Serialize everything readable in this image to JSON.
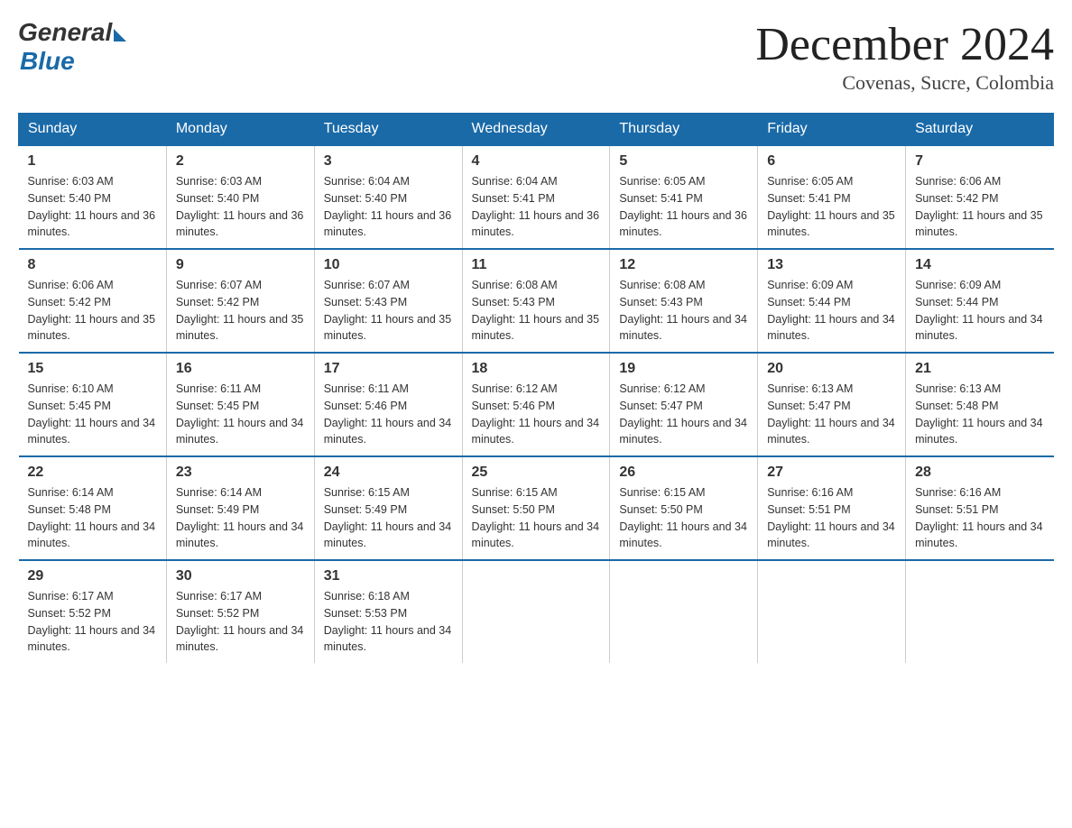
{
  "header": {
    "logo_general": "General",
    "logo_blue": "Blue",
    "month_title": "December 2024",
    "location": "Covenas, Sucre, Colombia"
  },
  "weekdays": [
    "Sunday",
    "Monday",
    "Tuesday",
    "Wednesday",
    "Thursday",
    "Friday",
    "Saturday"
  ],
  "weeks": [
    [
      {
        "day": "1",
        "sunrise": "6:03 AM",
        "sunset": "5:40 PM",
        "daylight": "11 hours and 36 minutes."
      },
      {
        "day": "2",
        "sunrise": "6:03 AM",
        "sunset": "5:40 PM",
        "daylight": "11 hours and 36 minutes."
      },
      {
        "day": "3",
        "sunrise": "6:04 AM",
        "sunset": "5:40 PM",
        "daylight": "11 hours and 36 minutes."
      },
      {
        "day": "4",
        "sunrise": "6:04 AM",
        "sunset": "5:41 PM",
        "daylight": "11 hours and 36 minutes."
      },
      {
        "day": "5",
        "sunrise": "6:05 AM",
        "sunset": "5:41 PM",
        "daylight": "11 hours and 36 minutes."
      },
      {
        "day": "6",
        "sunrise": "6:05 AM",
        "sunset": "5:41 PM",
        "daylight": "11 hours and 35 minutes."
      },
      {
        "day": "7",
        "sunrise": "6:06 AM",
        "sunset": "5:42 PM",
        "daylight": "11 hours and 35 minutes."
      }
    ],
    [
      {
        "day": "8",
        "sunrise": "6:06 AM",
        "sunset": "5:42 PM",
        "daylight": "11 hours and 35 minutes."
      },
      {
        "day": "9",
        "sunrise": "6:07 AM",
        "sunset": "5:42 PM",
        "daylight": "11 hours and 35 minutes."
      },
      {
        "day": "10",
        "sunrise": "6:07 AM",
        "sunset": "5:43 PM",
        "daylight": "11 hours and 35 minutes."
      },
      {
        "day": "11",
        "sunrise": "6:08 AM",
        "sunset": "5:43 PM",
        "daylight": "11 hours and 35 minutes."
      },
      {
        "day": "12",
        "sunrise": "6:08 AM",
        "sunset": "5:43 PM",
        "daylight": "11 hours and 34 minutes."
      },
      {
        "day": "13",
        "sunrise": "6:09 AM",
        "sunset": "5:44 PM",
        "daylight": "11 hours and 34 minutes."
      },
      {
        "day": "14",
        "sunrise": "6:09 AM",
        "sunset": "5:44 PM",
        "daylight": "11 hours and 34 minutes."
      }
    ],
    [
      {
        "day": "15",
        "sunrise": "6:10 AM",
        "sunset": "5:45 PM",
        "daylight": "11 hours and 34 minutes."
      },
      {
        "day": "16",
        "sunrise": "6:11 AM",
        "sunset": "5:45 PM",
        "daylight": "11 hours and 34 minutes."
      },
      {
        "day": "17",
        "sunrise": "6:11 AM",
        "sunset": "5:46 PM",
        "daylight": "11 hours and 34 minutes."
      },
      {
        "day": "18",
        "sunrise": "6:12 AM",
        "sunset": "5:46 PM",
        "daylight": "11 hours and 34 minutes."
      },
      {
        "day": "19",
        "sunrise": "6:12 AM",
        "sunset": "5:47 PM",
        "daylight": "11 hours and 34 minutes."
      },
      {
        "day": "20",
        "sunrise": "6:13 AM",
        "sunset": "5:47 PM",
        "daylight": "11 hours and 34 minutes."
      },
      {
        "day": "21",
        "sunrise": "6:13 AM",
        "sunset": "5:48 PM",
        "daylight": "11 hours and 34 minutes."
      }
    ],
    [
      {
        "day": "22",
        "sunrise": "6:14 AM",
        "sunset": "5:48 PM",
        "daylight": "11 hours and 34 minutes."
      },
      {
        "day": "23",
        "sunrise": "6:14 AM",
        "sunset": "5:49 PM",
        "daylight": "11 hours and 34 minutes."
      },
      {
        "day": "24",
        "sunrise": "6:15 AM",
        "sunset": "5:49 PM",
        "daylight": "11 hours and 34 minutes."
      },
      {
        "day": "25",
        "sunrise": "6:15 AM",
        "sunset": "5:50 PM",
        "daylight": "11 hours and 34 minutes."
      },
      {
        "day": "26",
        "sunrise": "6:15 AM",
        "sunset": "5:50 PM",
        "daylight": "11 hours and 34 minutes."
      },
      {
        "day": "27",
        "sunrise": "6:16 AM",
        "sunset": "5:51 PM",
        "daylight": "11 hours and 34 minutes."
      },
      {
        "day": "28",
        "sunrise": "6:16 AM",
        "sunset": "5:51 PM",
        "daylight": "11 hours and 34 minutes."
      }
    ],
    [
      {
        "day": "29",
        "sunrise": "6:17 AM",
        "sunset": "5:52 PM",
        "daylight": "11 hours and 34 minutes."
      },
      {
        "day": "30",
        "sunrise": "6:17 AM",
        "sunset": "5:52 PM",
        "daylight": "11 hours and 34 minutes."
      },
      {
        "day": "31",
        "sunrise": "6:18 AM",
        "sunset": "5:53 PM",
        "daylight": "11 hours and 34 minutes."
      },
      null,
      null,
      null,
      null
    ]
  ]
}
